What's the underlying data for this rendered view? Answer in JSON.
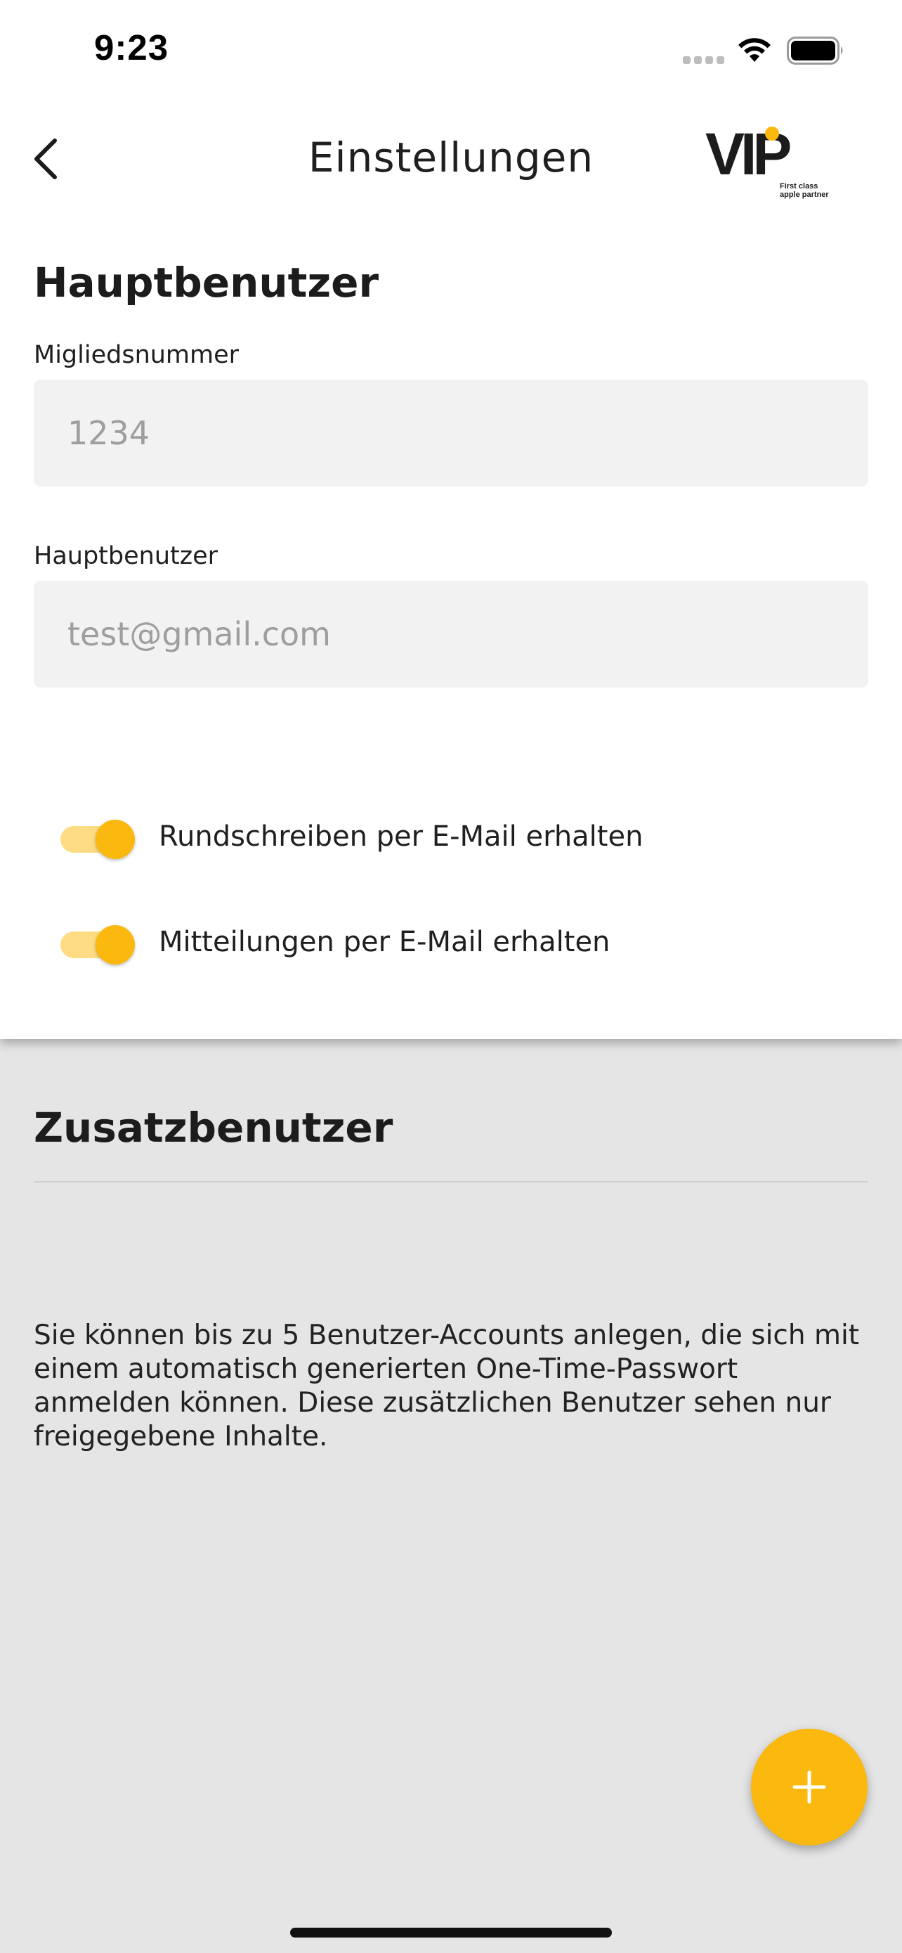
{
  "status_bar": {
    "time": "9:23",
    "icons": [
      "signal-dots-icon",
      "wifi-icon",
      "battery-icon"
    ]
  },
  "nav": {
    "back_icon": "chevron-left-icon",
    "title": "Einstellungen",
    "logo": {
      "wordmark": "VIP",
      "tagline_line1": "First class",
      "tagline_line2": "apple partner"
    }
  },
  "main_user": {
    "heading": "Hauptbenutzer",
    "member_number": {
      "label": "Migliedsnummer",
      "value": "1234"
    },
    "main_user_email": {
      "label": "Hauptbenutzer",
      "value": "test@gmail.com"
    },
    "toggles": [
      {
        "label": "Rundschreiben per E-Mail erhalten",
        "on": true
      },
      {
        "label": "Mitteilungen per E-Mail erhalten",
        "on": true
      }
    ]
  },
  "additional_users": {
    "heading": "Zusatzbenutzer",
    "info": "Sie können bis zu 5 Benutzer-Accounts anlegen, die sich mit einem automatisch generierten One-Time-Passwort anmelden können. Diese zusätzlichen Benutzer sehen nur freigegebene Inhalte.",
    "add_button_icon": "plus-icon"
  },
  "colors": {
    "accent": "#fbb80e",
    "accent_track": "#fddc83",
    "input_bg": "#f2f2f2",
    "lower_bg": "#e5e5e5"
  }
}
